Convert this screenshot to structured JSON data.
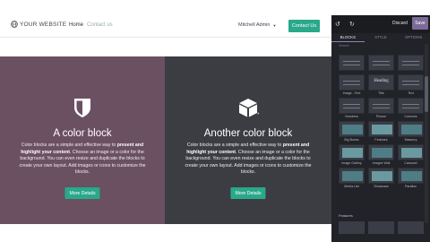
{
  "site": {
    "logo_text": "YOUR WEBSITE",
    "nav": {
      "home": "Home",
      "contact": "Contact us"
    },
    "user": "Mitchell Admin",
    "contact_button": "Contact Us"
  },
  "blocks": [
    {
      "title": "A color block",
      "text_pre": "Color blocks are a simple and effective way to ",
      "text_bold": "present and highlight your content",
      "text_post": ". Choose an image or a color for the background. You can even resize and duplicate the blocks to create your own layout. Add images or icons to customize the blocks.",
      "button": "More Details",
      "icon": "shield-icon"
    },
    {
      "title": "Another color block",
      "text_pre": "Color blocks are a simple and effective way to ",
      "text_bold": "present and highlight your content",
      "text_post": ". Choose an image or a color for the background. You can even resize and duplicate the blocks to create your own layout. Add images or icons to customize the blocks.",
      "button": "More Details",
      "icon": "cube-icon"
    }
  ],
  "editor": {
    "discard": "Discard",
    "save": "Save",
    "tabs": [
      "BLOCKS",
      "STYLE",
      "OPTIONS"
    ],
    "active_tab": "BLOCKS",
    "search": "Search",
    "tiles": [
      {
        "label": ""
      },
      {
        "label": ""
      },
      {
        "label": ""
      },
      {
        "label": "Image - Text"
      },
      {
        "label": "Title"
      },
      {
        "label": "Text"
      },
      {
        "label": "Numbers"
      },
      {
        "label": "Picture"
      },
      {
        "label": "Columns"
      },
      {
        "label": "Big Boxes"
      },
      {
        "label": "Features"
      },
      {
        "label": "Masonry"
      },
      {
        "label": "Image Gallery"
      },
      {
        "label": "Images Wall"
      },
      {
        "label": "Carousel"
      },
      {
        "label": "Media List"
      },
      {
        "label": "Showcase"
      },
      {
        "label": "Parallax"
      }
    ],
    "title_thumb_text": "Heading",
    "features_label": "Features"
  },
  "colors": {
    "accent": "#2aa88a",
    "block_a": "#6b5062",
    "block_b": "#3b3d42",
    "save": "#7c6b98"
  }
}
